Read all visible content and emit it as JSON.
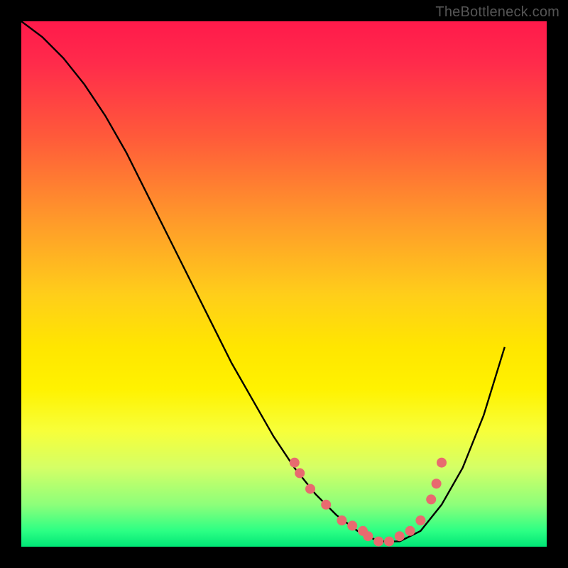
{
  "watermark": "TheBottleneck.com",
  "colors": {
    "background": "#000000",
    "curve": "#000000",
    "marker": "#e86a6f",
    "gradient_top": "#ff1a4b",
    "gradient_bottom": "#00e676"
  },
  "chart_data": {
    "type": "line",
    "title": "",
    "xlabel": "",
    "ylabel": "",
    "xlim": [
      0,
      100
    ],
    "ylim": [
      0,
      100
    ],
    "series": [
      {
        "name": "bottleneck-curve",
        "x": [
          0,
          4,
          8,
          12,
          16,
          20,
          24,
          28,
          32,
          36,
          40,
          44,
          48,
          52,
          56,
          60,
          64,
          68,
          72,
          76,
          80,
          84,
          88,
          92
        ],
        "values": [
          100,
          97,
          93,
          88,
          82,
          75,
          67,
          59,
          51,
          43,
          35,
          28,
          21,
          15,
          10,
          6,
          3,
          1,
          1,
          3,
          8,
          15,
          25,
          38
        ]
      }
    ],
    "markers": {
      "name": "highlighted-points",
      "x": [
        52,
        53,
        55,
        58,
        61,
        63,
        65,
        66,
        68,
        70,
        72,
        74,
        76,
        78,
        79,
        80
      ],
      "values": [
        16,
        14,
        11,
        8,
        5,
        4,
        3,
        2,
        1,
        1,
        2,
        3,
        5,
        9,
        12,
        16
      ]
    }
  }
}
